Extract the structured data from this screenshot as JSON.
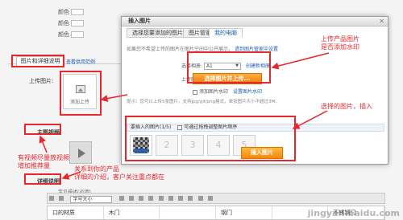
{
  "background": {
    "fields": [
      {
        "label": "颜色"
      },
      {
        "label": "颜色"
      },
      {
        "label": "颜色"
      }
    ],
    "pics_tab": "图片和详细说明",
    "product_link": "查看供用范例",
    "upload_label": "上传图片:",
    "upload_button": "添加上传",
    "main_image_label": "主图视频:",
    "detail_label": "详细说明:",
    "detail_sub": "宝贝描述(必填)",
    "font_size": "字号大小",
    "table_cols": [
      "口的材质",
      "木门",
      "",
      "钢门",
      "",
      "不锈钢门"
    ]
  },
  "dialog": {
    "title": "插入图片",
    "tabs": [
      "选择您要添加的图片",
      "图片管家",
      "我的电脑"
    ],
    "tip": "如果您不希望上传的图片在图片空间中公开展示，",
    "tip_link": "请到图片管家中设置",
    "album_label": "选择相册:",
    "album_value": "A1",
    "create_album": "创建新相册",
    "upload_label": "上传图片:",
    "upload_button": "选择图片并上传...",
    "watermark_label": "添加图片水印",
    "watermark_link": "设置图片水印",
    "hint": "提示：您可以上传5张图片，支持jpg/gif/png格式，单张图片大小不超过3M。",
    "selected_header": "要插入的图片(1/5)",
    "selected_option": "可通过拖拽调整图片顺序",
    "slots": [
      "",
      "2",
      "3",
      "4",
      "5"
    ],
    "insert_button": "插入图片"
  },
  "annotations": {
    "upload_note": "上传产品图片\n是否添加水印",
    "select_note": "选择的图片，插入",
    "video_note": "有视频尽量放视频\n增加推荐量",
    "detail_note": "关系到你的产品\n详细的介绍，客户关注重点都在"
  },
  "watermark": "jingyan.baidu.com"
}
